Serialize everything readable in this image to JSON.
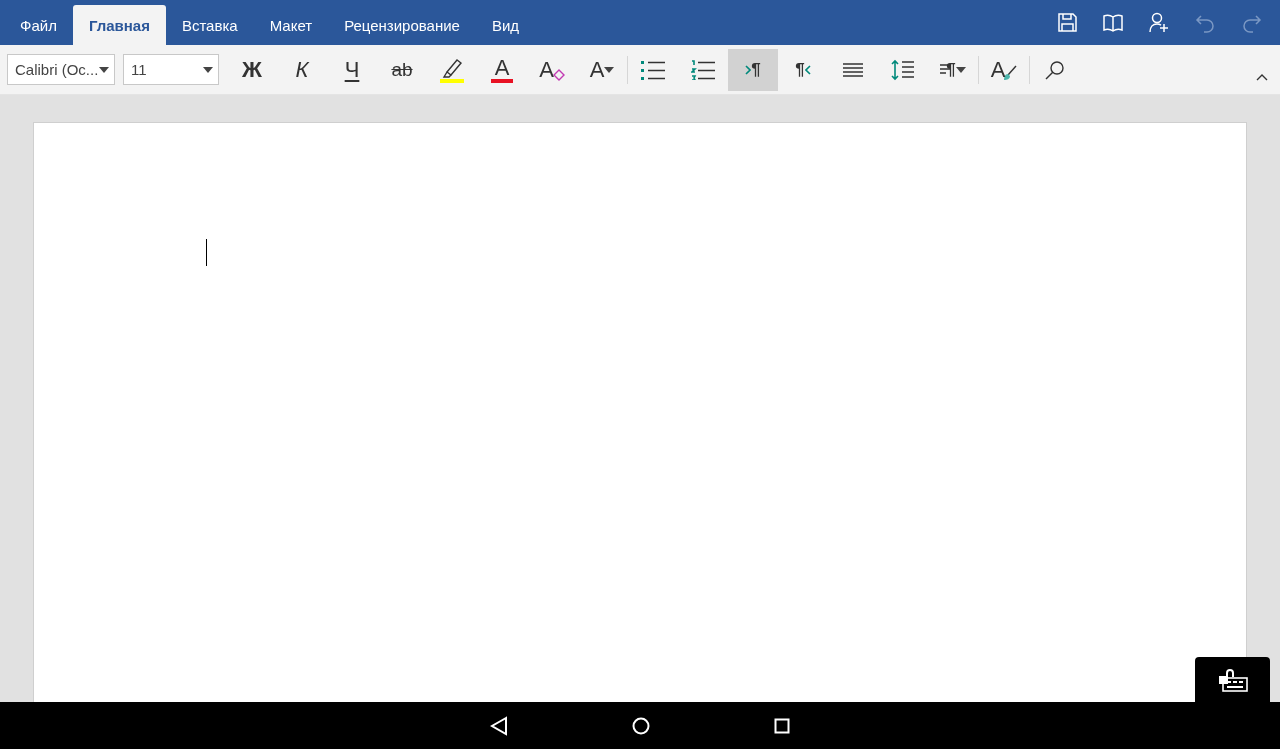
{
  "tabs": [
    {
      "label": "Файл",
      "selected": false
    },
    {
      "label": "Главная",
      "selected": true
    },
    {
      "label": "Вставка",
      "selected": false
    },
    {
      "label": "Макет",
      "selected": false
    },
    {
      "label": "Рецензирование",
      "selected": false
    },
    {
      "label": "Вид",
      "selected": false
    }
  ],
  "title_actions": [
    {
      "kind": "save",
      "disabled": false
    },
    {
      "kind": "book",
      "disabled": false
    },
    {
      "kind": "share",
      "disabled": false
    },
    {
      "kind": "undo",
      "disabled": true
    },
    {
      "kind": "redo",
      "disabled": true
    }
  ],
  "font_name": {
    "value": "Calibri (Oc..."
  },
  "font_size": {
    "value": "11"
  },
  "ribbon_buttons": [
    {
      "kind": "bold",
      "label": "Ж",
      "selected": false
    },
    {
      "kind": "italic",
      "label": "К",
      "selected": false
    },
    {
      "kind": "underline",
      "label": "Ч",
      "selected": false
    },
    {
      "kind": "strike",
      "label": "ab",
      "selected": false
    },
    {
      "kind": "highlight",
      "selected": false
    },
    {
      "kind": "fontcolor",
      "label": "A",
      "selected": false
    },
    {
      "kind": "clear",
      "label": "A",
      "selected": false
    },
    {
      "kind": "fontsize",
      "label": "A",
      "selected": false
    },
    {
      "kind": "sep"
    },
    {
      "kind": "bullets",
      "selected": false
    },
    {
      "kind": "numbering",
      "selected": false
    },
    {
      "kind": "ltr",
      "label": "¶",
      "selected": true
    },
    {
      "kind": "rtl",
      "label": "¶",
      "selected": false
    },
    {
      "kind": "align",
      "selected": false
    },
    {
      "kind": "spacing",
      "selected": false
    },
    {
      "kind": "styles",
      "label": "¶",
      "selected": false
    },
    {
      "kind": "sep"
    },
    {
      "kind": "styles_brush",
      "label": "A",
      "selected": false
    },
    {
      "kind": "sep"
    },
    {
      "kind": "search",
      "selected": false
    }
  ]
}
